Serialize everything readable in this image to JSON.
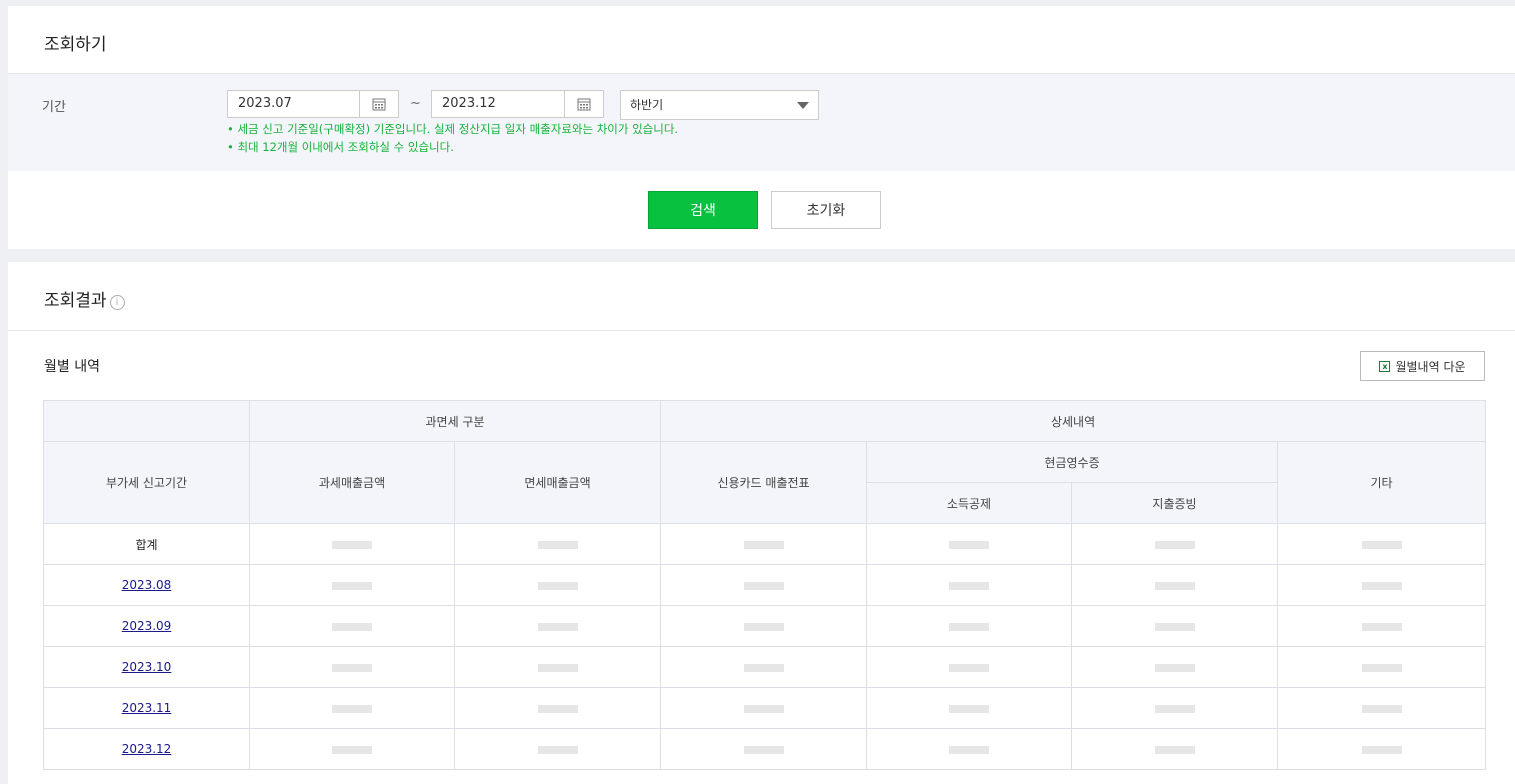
{
  "search": {
    "title": "조회하기",
    "period_label": "기간",
    "date_from": "2023.07",
    "date_to": "2023.12",
    "tilde": "~",
    "period_select": "하반기",
    "notices": [
      "• 세금 신고 기준일(구매확정) 기준입니다. 실제 정산지급 일자 매출자료와는 차이가 있습니다.",
      "• 최대 12개월 이내에서 조회하실 수 있습니다."
    ],
    "search_button": "검색",
    "reset_button": "초기화"
  },
  "result": {
    "title": "조회결과",
    "info_glyph": "i",
    "subtitle": "월별 내역",
    "download_button": "월별내역 다운",
    "table": {
      "group_tax": "과면세 구분",
      "group_detail": "상세내역",
      "col_period": "부가세 신고기간",
      "col_taxable": "과세매출금액",
      "col_taxfree": "면세매출금액",
      "col_card": "신용카드 매출전표",
      "group_cash": "현금영수증",
      "col_income": "소득공제",
      "col_expense": "지출증빙",
      "col_etc": "기타",
      "rows": [
        {
          "period": "합계",
          "link": false
        },
        {
          "period": "2023.08",
          "link": true
        },
        {
          "period": "2023.09",
          "link": true
        },
        {
          "period": "2023.10",
          "link": true
        },
        {
          "period": "2023.11",
          "link": true
        },
        {
          "period": "2023.12",
          "link": true
        }
      ]
    }
  }
}
